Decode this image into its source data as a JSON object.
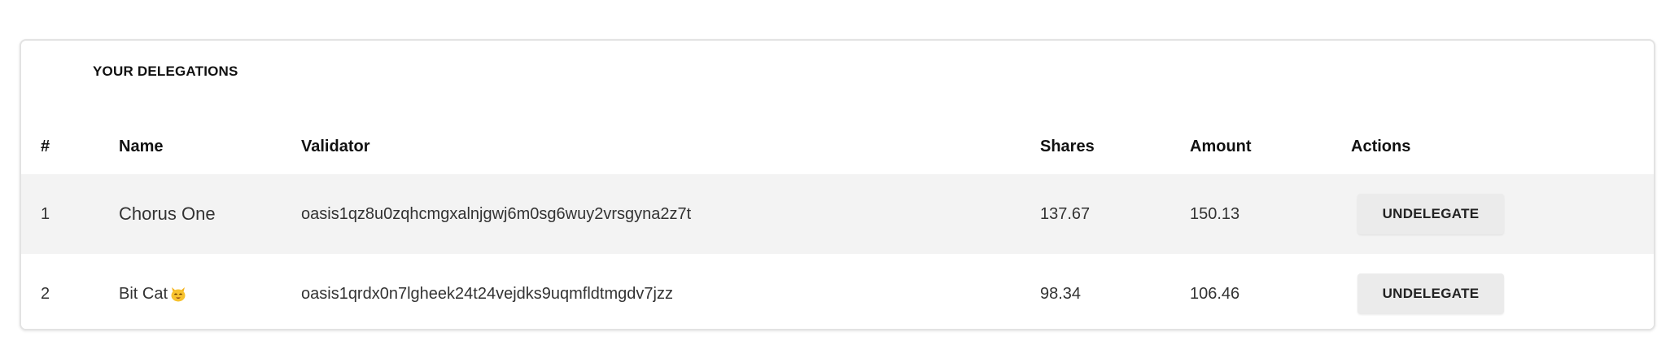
{
  "delegations": {
    "title": "YOUR DELEGATIONS",
    "columns": {
      "number": "#",
      "name": "Name",
      "validator": "Validator",
      "shares": "Shares",
      "amount": "Amount",
      "actions": "Actions"
    },
    "rows": [
      {
        "number": "1",
        "name": "Chorus One",
        "validator": "oasis1qz8u0zqhcmgxalnjgwj6m0sg6wuy2vrsgyna2z7t",
        "shares": "137.67",
        "amount": "150.13",
        "action_label": "UNDELEGATE"
      },
      {
        "number": "2",
        "name": "Bit Cat",
        "name_icon": "cat-emoji-icon",
        "validator": "oasis1qrdx0n7lgheek24t24vejdks9uqmfldtmgdv7jzz",
        "shares": "98.34",
        "amount": "106.46",
        "action_label": "UNDELEGATE"
      }
    ]
  }
}
